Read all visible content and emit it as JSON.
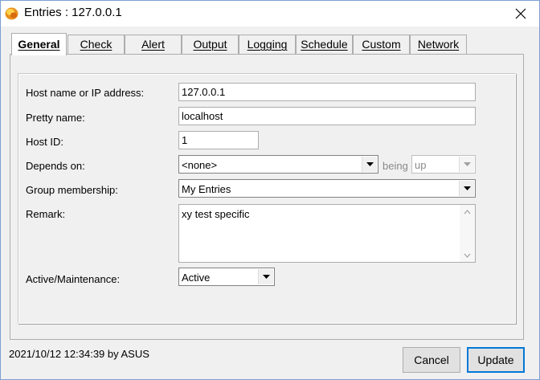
{
  "window": {
    "title": "Entries : 127.0.0.1"
  },
  "tabs": [
    {
      "label": "General",
      "active": true
    },
    {
      "label": "Check",
      "active": false
    },
    {
      "label": "Alert",
      "active": false
    },
    {
      "label": "Output",
      "active": false
    },
    {
      "label": "Logging",
      "active": false
    },
    {
      "label": "Schedule",
      "active": false
    },
    {
      "label": "Custom",
      "active": false
    },
    {
      "label": "Network",
      "active": false
    }
  ],
  "form": {
    "host": {
      "label": "Host name or IP address:",
      "value": "127.0.0.1"
    },
    "pretty": {
      "label": "Pretty name:",
      "value": "localhost"
    },
    "host_id": {
      "label": "Host ID:",
      "value": "1"
    },
    "depends": {
      "label": "Depends on:",
      "value": "<none>",
      "being_label": "being",
      "being_value": "up"
    },
    "group": {
      "label": "Group membership:",
      "value": "My Entries"
    },
    "remark": {
      "label": "Remark:",
      "value": "xy test specific"
    },
    "active": {
      "label": "Active/Maintenance:",
      "value": "Active"
    }
  },
  "footer": {
    "modified": "2021/10/12 12:34:39 by ASUS",
    "cancel_label": "Cancel",
    "update_label": "Update"
  },
  "colors": {
    "window_bg": "#f0f0f0",
    "accent": "#0078d7",
    "icon_orange": "#f0a020"
  }
}
